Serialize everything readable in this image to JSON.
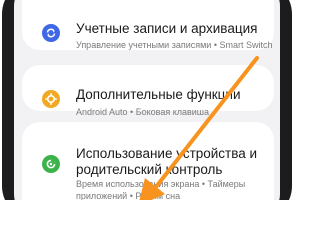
{
  "settings": {
    "items": [
      {
        "title": "Учетные записи и архивация",
        "subtitle": "Управление учетными записями • Smart Switch",
        "icon": "sync-icon",
        "icon_color": "#3e68e6"
      },
      {
        "title": "Дополнительные функции",
        "subtitle": "Android Auto • Боковая клавиша",
        "icon": "gear-plus-icon",
        "icon_color": "#f2a922"
      },
      {
        "title_line1": "Использование устройства и",
        "title_line2": "родительский контроль",
        "subtitle_line1": "Время использования экрана • Таймеры",
        "subtitle_line2": "приложений • Режим сна",
        "icon": "digital-wellbeing-icon",
        "icon_color": "#3bb34a"
      }
    ]
  },
  "annotation": {
    "arrow_icon": "arrow-pointer-icon",
    "arrow_color": "#f7931e"
  },
  "device": {
    "frame_color": "#1c1c1e",
    "screen_bg": "#f2f2f4"
  }
}
